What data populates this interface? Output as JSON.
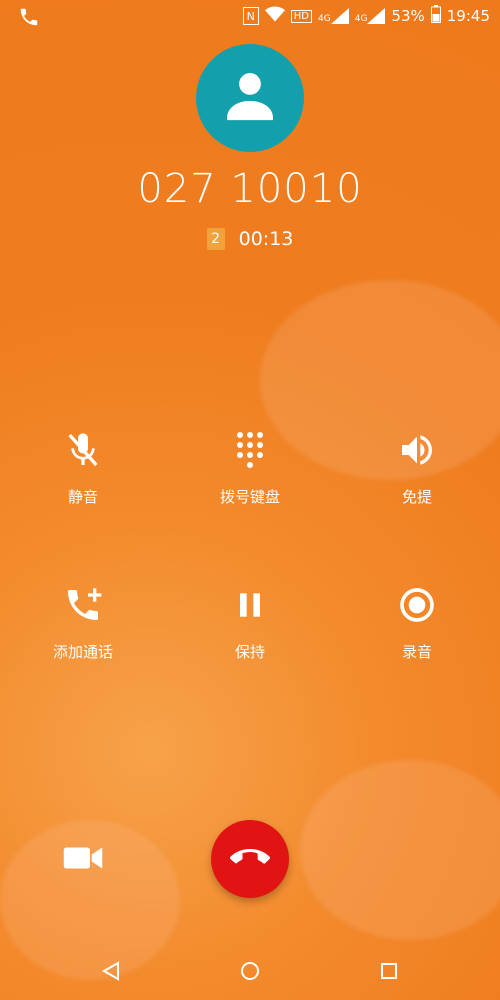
{
  "status_bar": {
    "call_icon": "phone-icon",
    "nfc": "N",
    "hd_label": "HD",
    "network1": "4G",
    "network2": "4G",
    "battery_percent": "53%",
    "time": "19:45"
  },
  "caller": {
    "avatar_icon": "person-icon",
    "number": "027 10010",
    "sim_label": "2",
    "duration": "00:13"
  },
  "actions": [
    {
      "label": "静音",
      "icon": "mute-mic-icon"
    },
    {
      "label": "拨号键盘",
      "icon": "dialpad-icon"
    },
    {
      "label": "免提",
      "icon": "speaker-icon"
    },
    {
      "label": "添加通话",
      "icon": "add-call-icon"
    },
    {
      "label": "保持",
      "icon": "pause-icon"
    },
    {
      "label": "录音",
      "icon": "record-icon"
    }
  ],
  "bottom": {
    "video_icon": "video-camera-icon",
    "end_call_icon": "end-call-icon",
    "end_call_color": "#e21313"
  },
  "nav": {
    "back_icon": "back-icon",
    "home_icon": "home-icon",
    "recents_icon": "recents-icon"
  },
  "colors": {
    "background": "#ee7a1c",
    "avatar": "#13a0ac"
  }
}
